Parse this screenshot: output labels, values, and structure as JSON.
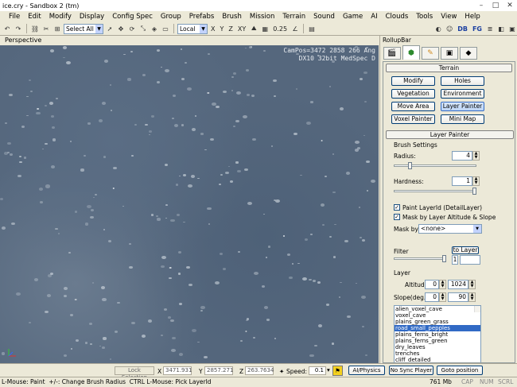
{
  "window": {
    "title": "ice.cry - Sandbox 2 (tm)"
  },
  "menu": [
    "File",
    "Edit",
    "Modify",
    "Display",
    "Config Spec",
    "Group",
    "Prefabs",
    "Brush",
    "Mission",
    "Terrain",
    "Sound",
    "Game",
    "AI",
    "Clouds",
    "Tools",
    "View",
    "Help"
  ],
  "toolbar": {
    "select_mode": "Select All",
    "coord_system": "Local",
    "axes": [
      "X",
      "Y",
      "Z",
      "XY"
    ],
    "grid_value": "0.25",
    "right_letters": [
      "DB",
      "FG"
    ]
  },
  "viewport": {
    "label": "Perspective",
    "cam_text_line1": "CamPos=3472 2858 266 Ang",
    "cam_text_line2": "DX10 32bit MedSpec D"
  },
  "rollup": {
    "title": "RollupBar",
    "terrain_section": "Terrain",
    "terrain_buttons": [
      "Modify",
      "Holes",
      "Vegetation",
      "Environment",
      "Move Area",
      "Layer Painter",
      "Voxel Painter",
      "Mini Map"
    ],
    "active_terrain_button": "Layer Painter",
    "layer_painter_section": "Layer Painter",
    "brush_settings_label": "Brush Settings",
    "radius_label": "Radius:",
    "radius_value": "4",
    "hardness_label": "Hardness:",
    "hardness_value": "1",
    "paint_layerid_label": "Paint LayerId (DetailLayer)",
    "mask_altitude_label": "Mask by Layer Altitude & Slope",
    "mask_by_label": "Mask by",
    "mask_by_value": "<none>",
    "filter_label": "Filter",
    "to_layer_button": "to Layer",
    "filter_value": "1",
    "layer_label": "Layer",
    "altitude_label": "Altitude",
    "altitude_min": "0",
    "altitude_max": "1024",
    "slope_label": "Slope(deg.)",
    "slope_min": "0",
    "slope_max": "90",
    "layers": [
      "alien_voxel_cave",
      "voxel_cave",
      "plains_green_grass",
      "road_small_pepples",
      "plains_ferns_bright",
      "plains_ferns_green",
      "dry_leaves",
      "trenches",
      "cliff_detailed"
    ],
    "selected_layer": "road_small_pepples"
  },
  "statusbar": {
    "lock_selection": "Lock Selection",
    "x_label": "X",
    "x_value": "3471.931",
    "y_label": "Y",
    "y_value": "2857.271",
    "z_label": "Z",
    "z_value": "263.7634",
    "speed_label": "Speed:",
    "speed_value": "0.1",
    "ai_physics": "AI/Physics",
    "no_sync_player": "No Sync Player",
    "goto_position": "Goto position",
    "hint": "L-Mouse: Paint  +/-: Change Brush Radius  CTRL L-Mouse: Pick LayerId",
    "memory": "761 Mb",
    "indicators": [
      "CAP",
      "NUM",
      "SCRL"
    ]
  },
  "colors": {
    "accent": "#316ac5",
    "terrain": "#55677d"
  }
}
